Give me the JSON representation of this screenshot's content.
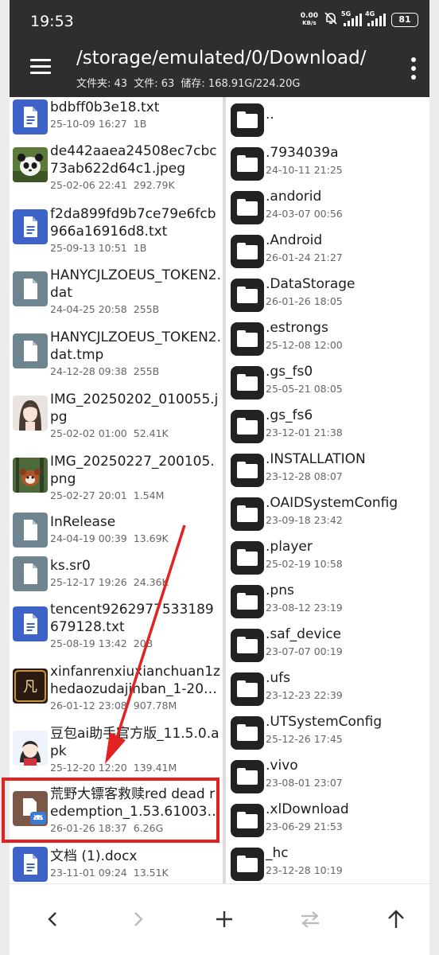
{
  "status": {
    "time": "19:53",
    "speed_top": "0.00",
    "speed_bottom": "KB/s",
    "net1": "5G",
    "net2": "4G",
    "battery": "81"
  },
  "header": {
    "path": "/storage/emulated/0/Download/",
    "folders_label": "文件夹: 43",
    "files_label": "文件: 63",
    "storage_label": "储存: 168.91G/224.20G"
  },
  "left_files": [
    {
      "name": "bdbff0b3e18.txt",
      "date": "25-10-09 16:27",
      "size": "1B",
      "thumb": "doc-icon"
    },
    {
      "name": "de442aaea24508ec7cbc73ab622d64c1.jpeg",
      "date": "25-02-06 22:41",
      "size": "292.79K",
      "thumb": "panda-image"
    },
    {
      "name": "f2da899fd9b7ce79e6fcb966a16916d8.txt",
      "date": "25-09-13 10:51",
      "size": "1B",
      "thumb": "doc-icon"
    },
    {
      "name": "HANYCJLZOEUS_TOKEN2.dat",
      "date": "24-04-25 20:58",
      "size": "255B",
      "thumb": "file-icon"
    },
    {
      "name": "HANYCJLZOEUS_TOKEN2.dat.tmp",
      "date": "24-12-28 09:38",
      "size": "255B",
      "thumb": "file-icon"
    },
    {
      "name": "IMG_20250202_010055.jpg",
      "date": "25-02-02 01:00",
      "size": "52.41K",
      "thumb": "girl-image"
    },
    {
      "name": "IMG_20250227_200105.png",
      "date": "25-02-27 20:01",
      "size": "1.54M",
      "thumb": "redpanda-image"
    },
    {
      "name": "InRelease",
      "date": "24-04-19 00:39",
      "size": "13.69K",
      "thumb": "file-icon"
    },
    {
      "name": "ks.sr0",
      "date": "25-12-17 19:26",
      "size": "24.36K",
      "thumb": "file-icon"
    },
    {
      "name": "tencent9262977533189679128.txt",
      "date": "25-08-19 13:42",
      "size": "20B",
      "thumb": "doc-icon"
    },
    {
      "name": "xinfanrenxiuxianchuan1zhedaozudajinban_1-2026…",
      "date": "26-01-12 23:08",
      "size": "907.78M",
      "thumb": "game-apk"
    },
    {
      "name": "豆包ai助手官方版_11.5.0.apk",
      "date": "25-12-20 12:20",
      "size": "139.41M",
      "thumb": "doubao-apk"
    },
    {
      "name": "荒野大镖客救赎red dead redemption_1.53.61003…",
      "date": "26-01-26 18:37",
      "size": "6.26G",
      "thumb": "android-apk"
    },
    {
      "name": "文档 (1).docx",
      "date": "23-11-01 09:24",
      "size": "13.51K",
      "thumb": "doc-icon"
    }
  ],
  "right_folders": [
    {
      "name": "..",
      "date": ""
    },
    {
      "name": ".7934039a",
      "date": "24-10-11 21:25"
    },
    {
      "name": ".andorid",
      "date": "24-03-07 00:56"
    },
    {
      "name": ".Android",
      "date": "26-01-24 21:27"
    },
    {
      "name": ".DataStorage",
      "date": "26-01-26 18:05"
    },
    {
      "name": ".estrongs",
      "date": "25-12-08 12:00"
    },
    {
      "name": ".gs_fs0",
      "date": "25-05-21 08:05"
    },
    {
      "name": ".gs_fs6",
      "date": "23-12-01 21:38"
    },
    {
      "name": ".INSTALLATION",
      "date": "23-12-28 08:07"
    },
    {
      "name": ".OAIDSystemConfig",
      "date": "23-09-18 23:42"
    },
    {
      "name": ".player",
      "date": "25-02-19 10:58"
    },
    {
      "name": ".pns",
      "date": "23-08-12 23:19"
    },
    {
      "name": ".saf_device",
      "date": "23-07-07 00:19"
    },
    {
      "name": ".ufs",
      "date": "23-12-23 22:39"
    },
    {
      "name": ".UTSystemConfig",
      "date": "25-12-26 17:45"
    },
    {
      "name": ".vivo",
      "date": "23-08-01 23:07"
    },
    {
      "name": ".xlDownload",
      "date": "23-06-29 21:53"
    },
    {
      "name": "_hc",
      "date": "23-12-28 10:19"
    }
  ],
  "colors": {
    "header_bg": "#2e2e2e",
    "doc_blue": "#3d63c9",
    "file_gray": "#6e848f",
    "apk_brown": "#7b5747",
    "highlight_red": "#e32121"
  }
}
